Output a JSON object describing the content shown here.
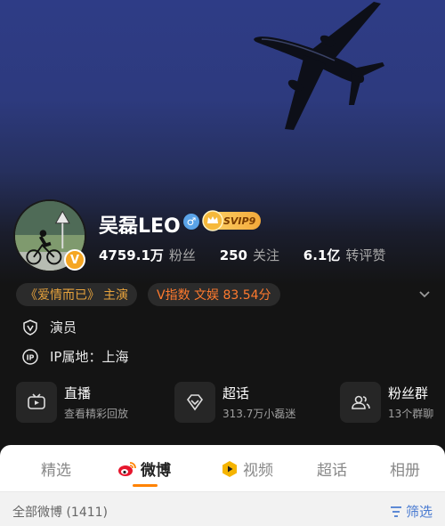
{
  "profile": {
    "name": "吴磊LEO",
    "verified_mark": "V",
    "svip_label": "SVIP9",
    "gender_symbol": "♂"
  },
  "stats": {
    "followers_value": "4759.1万",
    "followers_label": "粉丝",
    "following_value": "250",
    "following_label": "关注",
    "reposts_value": "6.1亿",
    "reposts_label": "转评赞"
  },
  "tags": {
    "works": "《爱情而已》",
    "works_role": "主演",
    "vindex": "V指数 文娱 83.54分"
  },
  "info": {
    "career": "演员",
    "ip": "IP属地：上海"
  },
  "features": {
    "live_title": "直播",
    "live_sub": "查看精彩回放",
    "topic_title": "超话",
    "topic_sub": "313.7万小磊迷",
    "group_title": "粉丝群",
    "group_sub": "13个群聊"
  },
  "tabs": {
    "featured": "精选",
    "weibo": "微博",
    "video": "视频",
    "supertopic": "超话",
    "album": "相册"
  },
  "filter": {
    "all_weibo": "全部微博 (1411)",
    "filter_label": "筛选"
  },
  "colors": {
    "accent": "#ff8200",
    "vindex": "#ff7a2e",
    "works": "#e6a23c",
    "filter_blue": "#4a7bd1"
  }
}
